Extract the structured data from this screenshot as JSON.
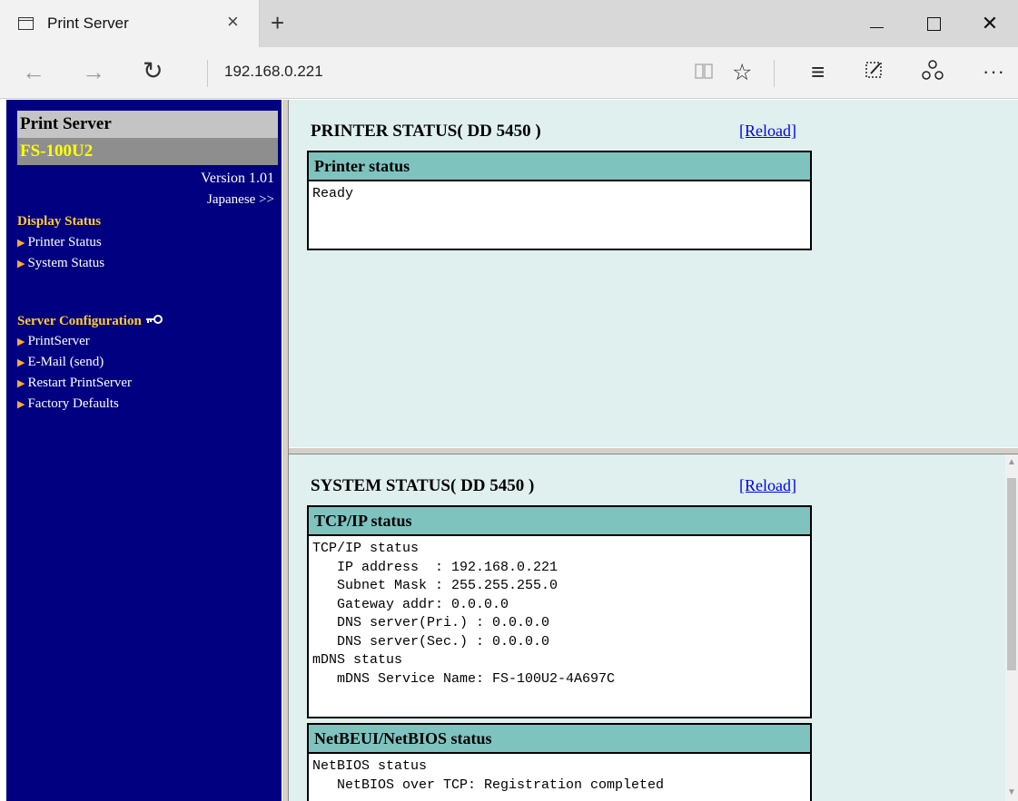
{
  "browser": {
    "tab_title": "Print Server",
    "tab_close": "×",
    "new_tab": "+",
    "url": "192.168.0.221",
    "icons": {
      "back": "←",
      "forward": "→",
      "refresh": "↻",
      "reading_view": "📖",
      "favorite": "☆",
      "hub": "≡",
      "web_note": "✎",
      "share": "⟲",
      "more": "···",
      "close": "✕"
    }
  },
  "sidebar": {
    "title": "Print Server",
    "model": "FS-100U2",
    "version": "Version 1.01",
    "language_link": "Japanese >>",
    "display_status": {
      "heading": "Display Status",
      "items": [
        "Printer Status",
        "System Status"
      ]
    },
    "server_config": {
      "heading": "Server Configuration",
      "key_icon": "⊸",
      "items": [
        "PrintServer",
        "E-Mail (send)",
        "Restart PrintServer",
        "Factory Defaults"
      ]
    }
  },
  "printer_status": {
    "title": "PRINTER STATUS( DD 5450 )",
    "reload": "[Reload]",
    "box_head": "Printer status",
    "box_body": "Ready"
  },
  "system_status": {
    "title": "SYSTEM STATUS( DD 5450 )",
    "reload": "[Reload]",
    "tcpip_head": "TCP/IP status",
    "tcpip_body": "TCP/IP status\n   IP address  : 192.168.0.221\n   Subnet Mask : 255.255.255.0\n   Gateway addr: 0.0.0.0\n   DNS server(Pri.) : 0.0.0.0\n   DNS server(Sec.) : 0.0.0.0\nmDNS status\n   mDNS Service Name: FS-100U2-4A697C",
    "netbeui_head": "NetBEUI/NetBIOS status",
    "netbeui_body": "NetBIOS status\n   NetBIOS over TCP: Registration completed"
  }
}
